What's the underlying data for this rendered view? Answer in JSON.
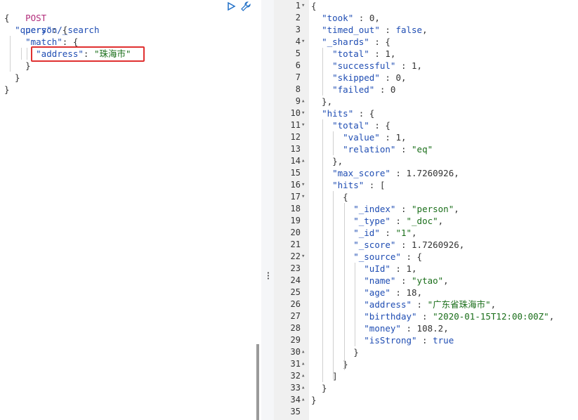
{
  "request": {
    "method": "POST",
    "path": "person/_search",
    "lines": [
      "{",
      "  \"query\": {",
      "    \"match\": {",
      "      \"address\": \"珠海市\"",
      "    }",
      "  }",
      "}"
    ]
  },
  "icons": {
    "run": "play-icon",
    "settings": "wrench-icon",
    "splitter": "drag-handle-icon"
  },
  "response": {
    "line_numbers": [
      "1",
      "2",
      "3",
      "4",
      "5",
      "6",
      "7",
      "8",
      "9",
      "10",
      "11",
      "12",
      "13",
      "14",
      "15",
      "16",
      "17",
      "18",
      "19",
      "20",
      "21",
      "22",
      "23",
      "24",
      "25",
      "26",
      "27",
      "28",
      "29",
      "30",
      "31",
      "32",
      "33",
      "34",
      "35"
    ],
    "lines": [
      "{",
      "  \"took\" : 0,",
      "  \"timed_out\" : false,",
      "  \"_shards\" : {",
      "    \"total\" : 1,",
      "    \"successful\" : 1,",
      "    \"skipped\" : 0,",
      "    \"failed\" : 0",
      "  },",
      "  \"hits\" : {",
      "    \"total\" : {",
      "      \"value\" : 1,",
      "      \"relation\" : \"eq\"",
      "    },",
      "    \"max_score\" : 1.7260926,",
      "    \"hits\" : [",
      "      {",
      "        \"_index\" : \"person\",",
      "        \"_type\" : \"_doc\",",
      "        \"_id\" : \"1\",",
      "        \"_score\" : 1.7260926,",
      "        \"_source\" : {",
      "          \"uId\" : 1,",
      "          \"name\" : \"ytao\",",
      "          \"age\" : 18,",
      "          \"address\" : \"广东省珠海市\",",
      "          \"birthday\" : \"2020-01-15T12:00:00Z\",",
      "          \"money\" : 108.2,",
      "          \"isStrong\" : true",
      "        }",
      "      }",
      "    ]",
      "  }",
      "}",
      ""
    ],
    "fold_lines": [
      1,
      4,
      9,
      10,
      11,
      14,
      16,
      17,
      22,
      30,
      31,
      32,
      33,
      34
    ]
  }
}
